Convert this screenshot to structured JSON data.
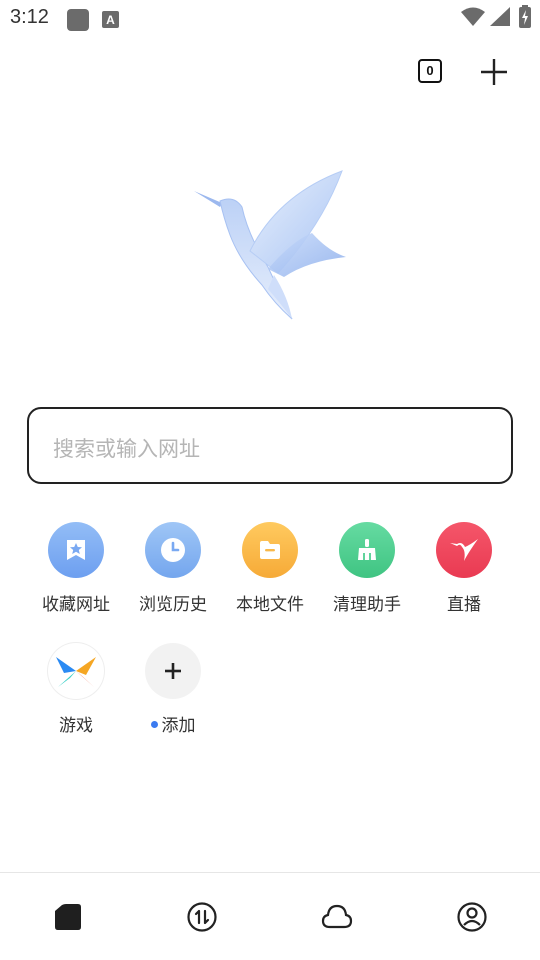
{
  "status_bar": {
    "time": "3:12",
    "icons": [
      "app-notification-icon",
      "a-letter-icon",
      "wifi-icon",
      "signal-icon",
      "battery-charging-icon"
    ]
  },
  "top_actions": {
    "tab_count": "0"
  },
  "search": {
    "placeholder": "搜索或输入网址"
  },
  "shortcuts": [
    {
      "label": "收藏网址",
      "icon": "bookmark-star-icon",
      "color": "#7aa9f2"
    },
    {
      "label": "浏览历史",
      "icon": "clock-icon",
      "color": "#88b5f0"
    },
    {
      "label": "本地文件",
      "icon": "folder-icon",
      "color": "#f8b84a"
    },
    {
      "label": "清理助手",
      "icon": "broom-icon",
      "color": "#4fd091"
    },
    {
      "label": "直播",
      "icon": "bird-icon",
      "color": "#f0445a"
    },
    {
      "label": "游戏",
      "icon": "game-x-icon",
      "color": "#ffffff"
    },
    {
      "label": "添加",
      "icon": "plus-icon",
      "color": "#f1f1f1"
    }
  ],
  "bottom_nav": [
    "home-icon",
    "transfer-icon",
    "cloud-icon",
    "profile-icon"
  ]
}
